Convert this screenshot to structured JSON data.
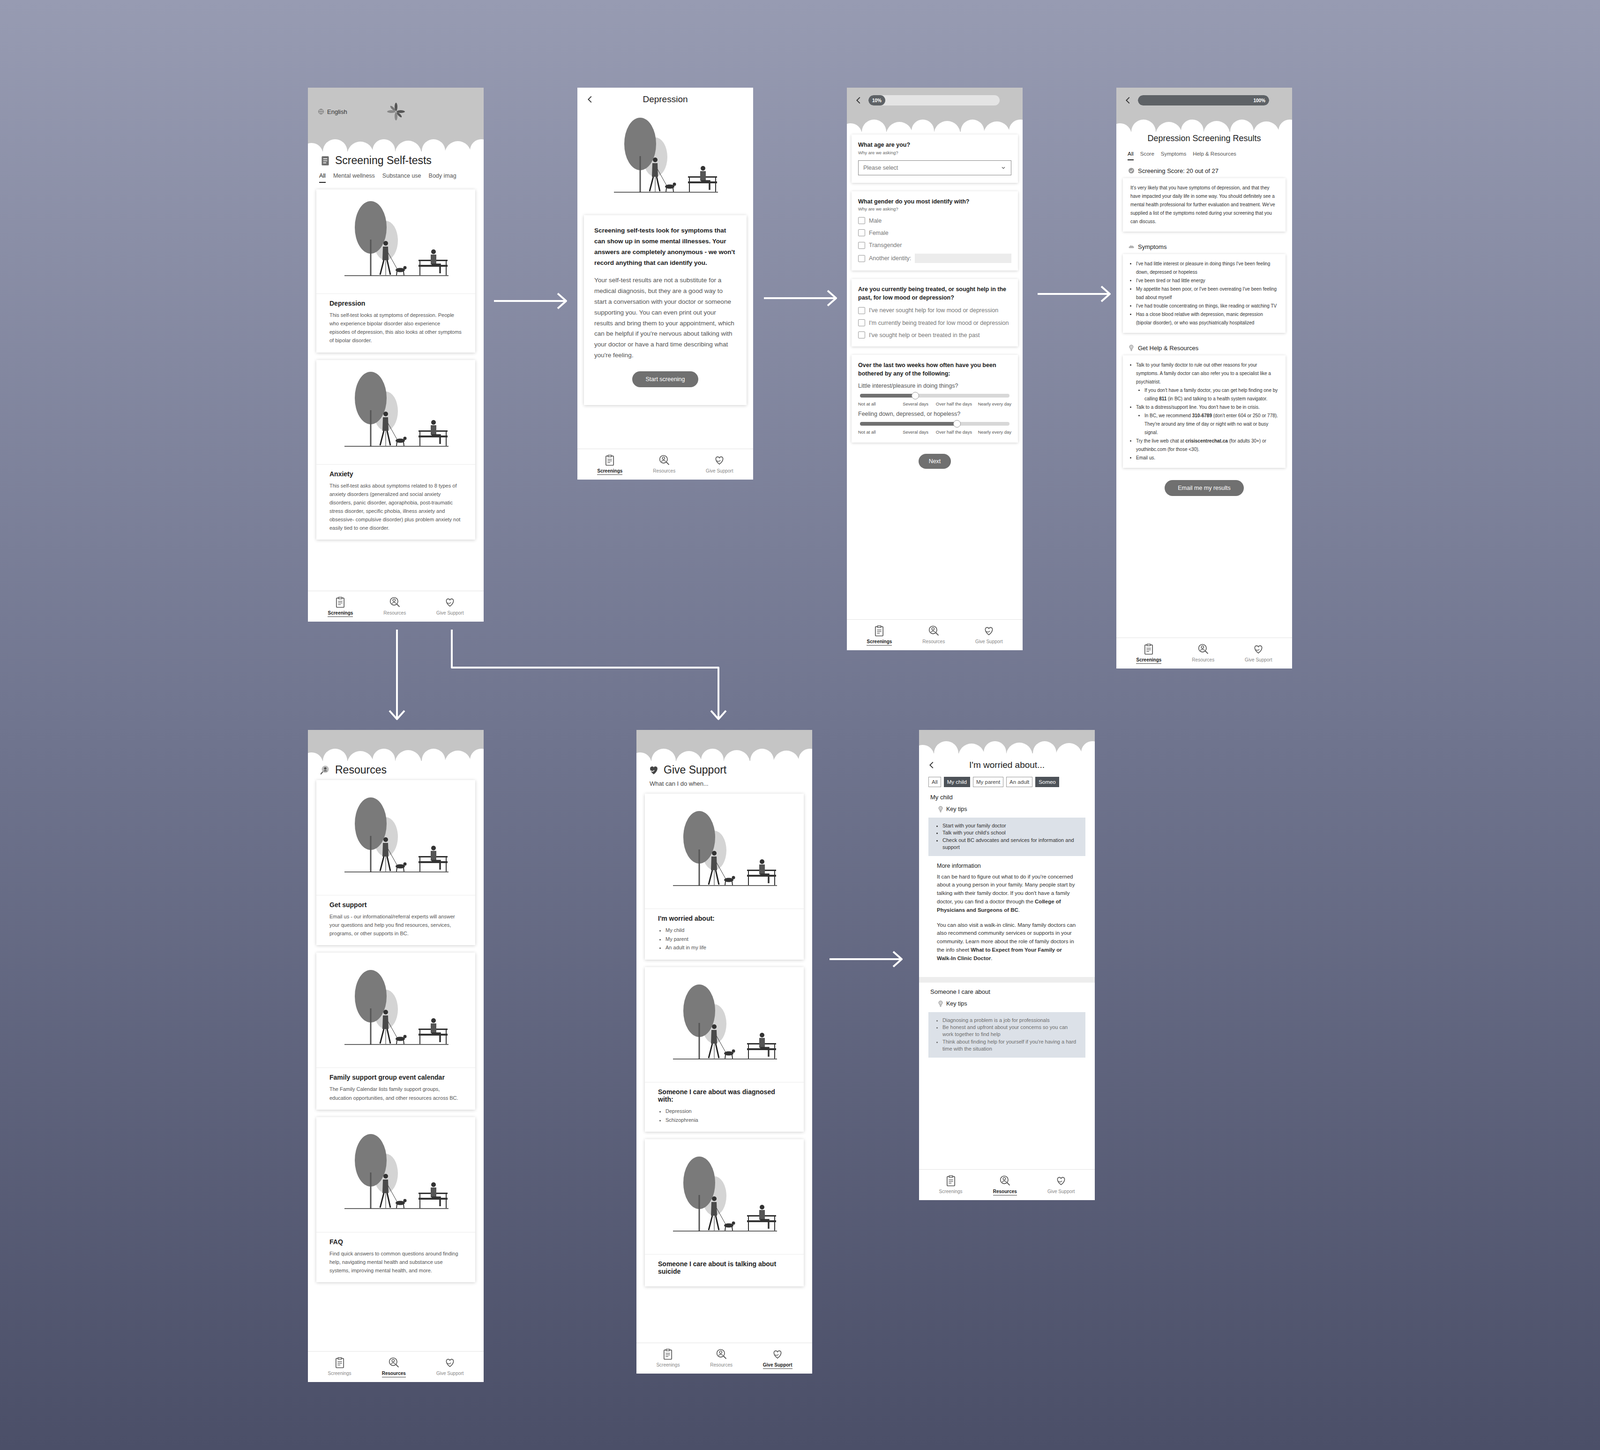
{
  "self_tests": {
    "language": "English",
    "title": "Screening Self-tests",
    "tabs": [
      {
        "label": "All",
        "selected": true
      },
      {
        "label": "Mental wellness",
        "selected": false
      },
      {
        "label": "Substance use",
        "selected": false
      },
      {
        "label": "Body imag",
        "selected": false
      }
    ],
    "cards": [
      {
        "title": "Depression",
        "text": "This self-test looks at symptoms of depression. People who experience bipolar disorder also experience episodes of depression, this also looks at other symptoms of bipolar disorder."
      },
      {
        "title": "Anxiety",
        "text": "This self-test asks about symptoms related to 8 types of anxiety disorders (generalized and social anxiety disorders, panic disorder, agoraphobia, post-traumatic stress disorder, specific phobia, illness anxiety and obsessive- compulsive disorder) plus problem anxiety not easily tied to one disorder."
      }
    ],
    "nav": [
      {
        "label": "Screenings",
        "selected": true
      },
      {
        "label": "Resources",
        "selected": false
      },
      {
        "label": "Give Support",
        "selected": false
      }
    ]
  },
  "intro": {
    "title": "Depression",
    "lead": "Screening self-tests look for symptoms that can show up in some mental illnesses. Your answers are completely anonymous - we won't record anything that can identify you.",
    "body": "Your self-test results are not a substitute for a medical diagnosis, but they are a good way to start a conversation with your doctor or someone supporting you. You can even print out your results and bring them to your appointment, which can be helpful if you're nervous about talking with your doctor or have a hard time describing what you're feeling.",
    "button": "Start screening",
    "nav": [
      {
        "label": "Screenings",
        "selected": true
      },
      {
        "label": "Resources",
        "selected": false
      },
      {
        "label": "Give Support",
        "selected": false
      }
    ]
  },
  "questionnaire": {
    "progress": {
      "label": "10%",
      "level": 0.1
    },
    "questions": [
      {
        "kind": "select",
        "label": "What age are you?",
        "hint": "Why are we asking?",
        "placeholder": "Please select"
      },
      {
        "kind": "checkbox",
        "label": "What gender do you most identify with?",
        "hint": "Why are we asking?",
        "options": [
          {
            "label": "Male",
            "checked": false,
            "field": false
          },
          {
            "label": "Female",
            "checked": false,
            "field": false
          },
          {
            "label": "Transgender",
            "checked": false,
            "field": false
          },
          {
            "label": "Another identity:",
            "checked": false,
            "field": true
          }
        ]
      },
      {
        "kind": "checkbox",
        "label": "Are you currently being treated, or sought help in the past, for low mood or depression?",
        "hint": "",
        "options": [
          {
            "label": "I've never sought help for low mood or depression",
            "checked": false,
            "field": false
          },
          {
            "label": "I'm currently being treated for low mood or depression",
            "checked": false,
            "field": false
          },
          {
            "label": "I've sought help or been treated in the past",
            "checked": false,
            "field": false
          }
        ]
      },
      {
        "kind": "sliders",
        "label": "Over the last two weeks how often have you been bothered by any of the following:",
        "hint": "",
        "scale": [
          "Not at all",
          "Several days",
          "Over half the days",
          "Nearly every day"
        ],
        "items": [
          {
            "label": "Little interest/pleasure in doing things?",
            "level": 0.37
          },
          {
            "label": "Feeling down, depressed, or hopeless?",
            "level": 0.65
          }
        ]
      }
    ],
    "button": "Next",
    "nav": [
      {
        "label": "Screenings",
        "selected": true
      },
      {
        "label": "Resources",
        "selected": false
      },
      {
        "label": "Give Support",
        "selected": false
      }
    ]
  },
  "results": {
    "progress": {
      "label": "100%",
      "level": 1
    },
    "title": "Depression Screening Results",
    "tabs": [
      {
        "label": "All",
        "selected": true
      },
      {
        "label": "Score",
        "selected": false
      },
      {
        "label": "Symptoms",
        "selected": false
      },
      {
        "label": "Help & Resources",
        "selected": false
      }
    ],
    "score": "Screening Score: 20 out of 27",
    "summary": "It's very likely that you have symptoms of depression, and that they have impacted your daily life in some way. You should definitely see a mental health professional for further evaluation and treatment. We've supplied a list of the symptoms noted during your screening that you can discuss.",
    "symptoms_title": "Symptoms",
    "symptoms": [
      "I've had little interest or pleasure in doing things I've been feeling down, depressed or hopeless",
      "I've been tired or had little energy",
      "My appetite has been poor, or I've been overeating I've been feeling bad about myself",
      "I've had trouble concentrating on things, like reading or watching TV",
      "Has a close blood relative with depression, manic depression (bipolar disorder), or who was psychiatrically hospitalized"
    ],
    "help_title": "Get Help & Resources",
    "help": [
      {
        "level": 0,
        "segments": [
          {
            "text": "Talk to your family doctor to rule out other reasons for your symptoms. A family doctor can also refer you to a specialist like a psychiatrist.",
            "bold": false
          }
        ]
      },
      {
        "level": 1,
        "segments": [
          {
            "text": "If you don't have a family doctor, you can get help finding one by calling ",
            "bold": false
          },
          {
            "text": "811",
            "bold": true
          },
          {
            "text": " (in BC) and talking to a health system navigator.",
            "bold": false
          }
        ]
      },
      {
        "level": 0,
        "segments": [
          {
            "text": "Talk to a distress/support line. You don't have to be in crisis.",
            "bold": false
          }
        ]
      },
      {
        "level": 1,
        "segments": [
          {
            "text": "In BC, we recommend ",
            "bold": false
          },
          {
            "text": "310-6789",
            "bold": true
          },
          {
            "text": " (don't enter 604 or 250 or 778). They're around any time of day or night with no wait or busy signal.",
            "bold": false
          }
        ]
      },
      {
        "level": 0,
        "segments": [
          {
            "text": "Try the live web chat at ",
            "bold": false
          },
          {
            "text": "crisiscentrechat.ca",
            "bold": true
          },
          {
            "text": " (for adults 30+) or  youthinbc.com (for those <30).",
            "bold": false
          }
        ]
      },
      {
        "level": 0,
        "segments": [
          {
            "text": "Email us.",
            "bold": false
          }
        ]
      }
    ],
    "button": "Email me my results",
    "nav": [
      {
        "label": "Screenings",
        "selected": true
      },
      {
        "label": "Resources",
        "selected": false
      },
      {
        "label": "Give Support",
        "selected": false
      }
    ]
  },
  "resources": {
    "title": "Resources",
    "cards": [
      {
        "title": "Get support",
        "text": "Email us - our informational/referral experts will answer your questions and help you find resources, services, programs, or other supports in BC."
      },
      {
        "title": "Family support group event calendar",
        "text": "The Family Calendar lists family support groups, education opportunities, and other resources across BC."
      },
      {
        "title": "FAQ",
        "text": "Find quick answers to common questions around finding help, navigating mental health and substance use systems, improving mental health, and more."
      }
    ],
    "nav": [
      {
        "label": "Screenings",
        "selected": false
      },
      {
        "label": "Resources",
        "selected": true
      },
      {
        "label": "Give Support",
        "selected": false
      }
    ]
  },
  "give_support": {
    "title": "Give Support",
    "subtitle": "What can I do when...",
    "cards": [
      {
        "title": "I'm worried about:",
        "items": [
          "My child",
          "My parent",
          "An adult in my life"
        ]
      },
      {
        "title": "Someone I care about was diagnosed with:",
        "items": [
          "Depression",
          "Schizophrenia"
        ]
      },
      {
        "title": "Someone I care about is talking about suicide",
        "items": []
      }
    ],
    "nav": [
      {
        "label": "Screenings",
        "selected": false
      },
      {
        "label": "Resources",
        "selected": false
      },
      {
        "label": "Give Support",
        "selected": true
      }
    ]
  },
  "worried": {
    "title": "I'm worried about...",
    "chips": [
      {
        "label": "All",
        "selected": false
      },
      {
        "label": "My child",
        "selected": true
      },
      {
        "label": "My parent",
        "selected": false
      },
      {
        "label": "An adult",
        "selected": false
      },
      {
        "label": "Someo",
        "selected": true
      }
    ],
    "sections": [
      {
        "title": "My child",
        "faded": false,
        "tips_label": "Key tips",
        "tips": [
          "Start with your family doctor",
          "Talk with your child's school",
          "Check out BC advocates and services for information and support"
        ],
        "more_label": "More information",
        "paragraphs": [
          [
            {
              "text": "It can be hard to figure out what to do if you're concerned about a young person in your family. Many people start by talking with their family doctor. If you don't have a family doctor, you can find a doctor through the ",
              "bold": false
            },
            {
              "text": "College of Physicians and Surgeons of BC",
              "bold": true
            },
            {
              "text": ".",
              "bold": false
            }
          ],
          [
            {
              "text": "You can also visit a walk-in clinic. Many family doctors can also recommend community services or supports in your community. Learn more about the role of family doctors in the info sheet ",
              "bold": false
            },
            {
              "text": "What to Expect from Your Family or Walk-In Clinic Doctor",
              "bold": true
            },
            {
              "text": ".",
              "bold": false
            }
          ]
        ]
      },
      {
        "title": "Someone I care about",
        "faded": true,
        "tips_label": "Key tips",
        "tips": [
          "Diagnosing a problem is a job for professionals",
          "Be honest and upfront about your concerns so you can work together to find help",
          "Think about finding help for yourself if you're having a hard time with the situation"
        ],
        "more_label": "",
        "paragraphs": []
      }
    ],
    "nav": [
      {
        "label": "Screenings",
        "selected": false
      },
      {
        "label": "Resources",
        "selected": true
      },
      {
        "label": "Give Support",
        "selected": false
      }
    ]
  }
}
